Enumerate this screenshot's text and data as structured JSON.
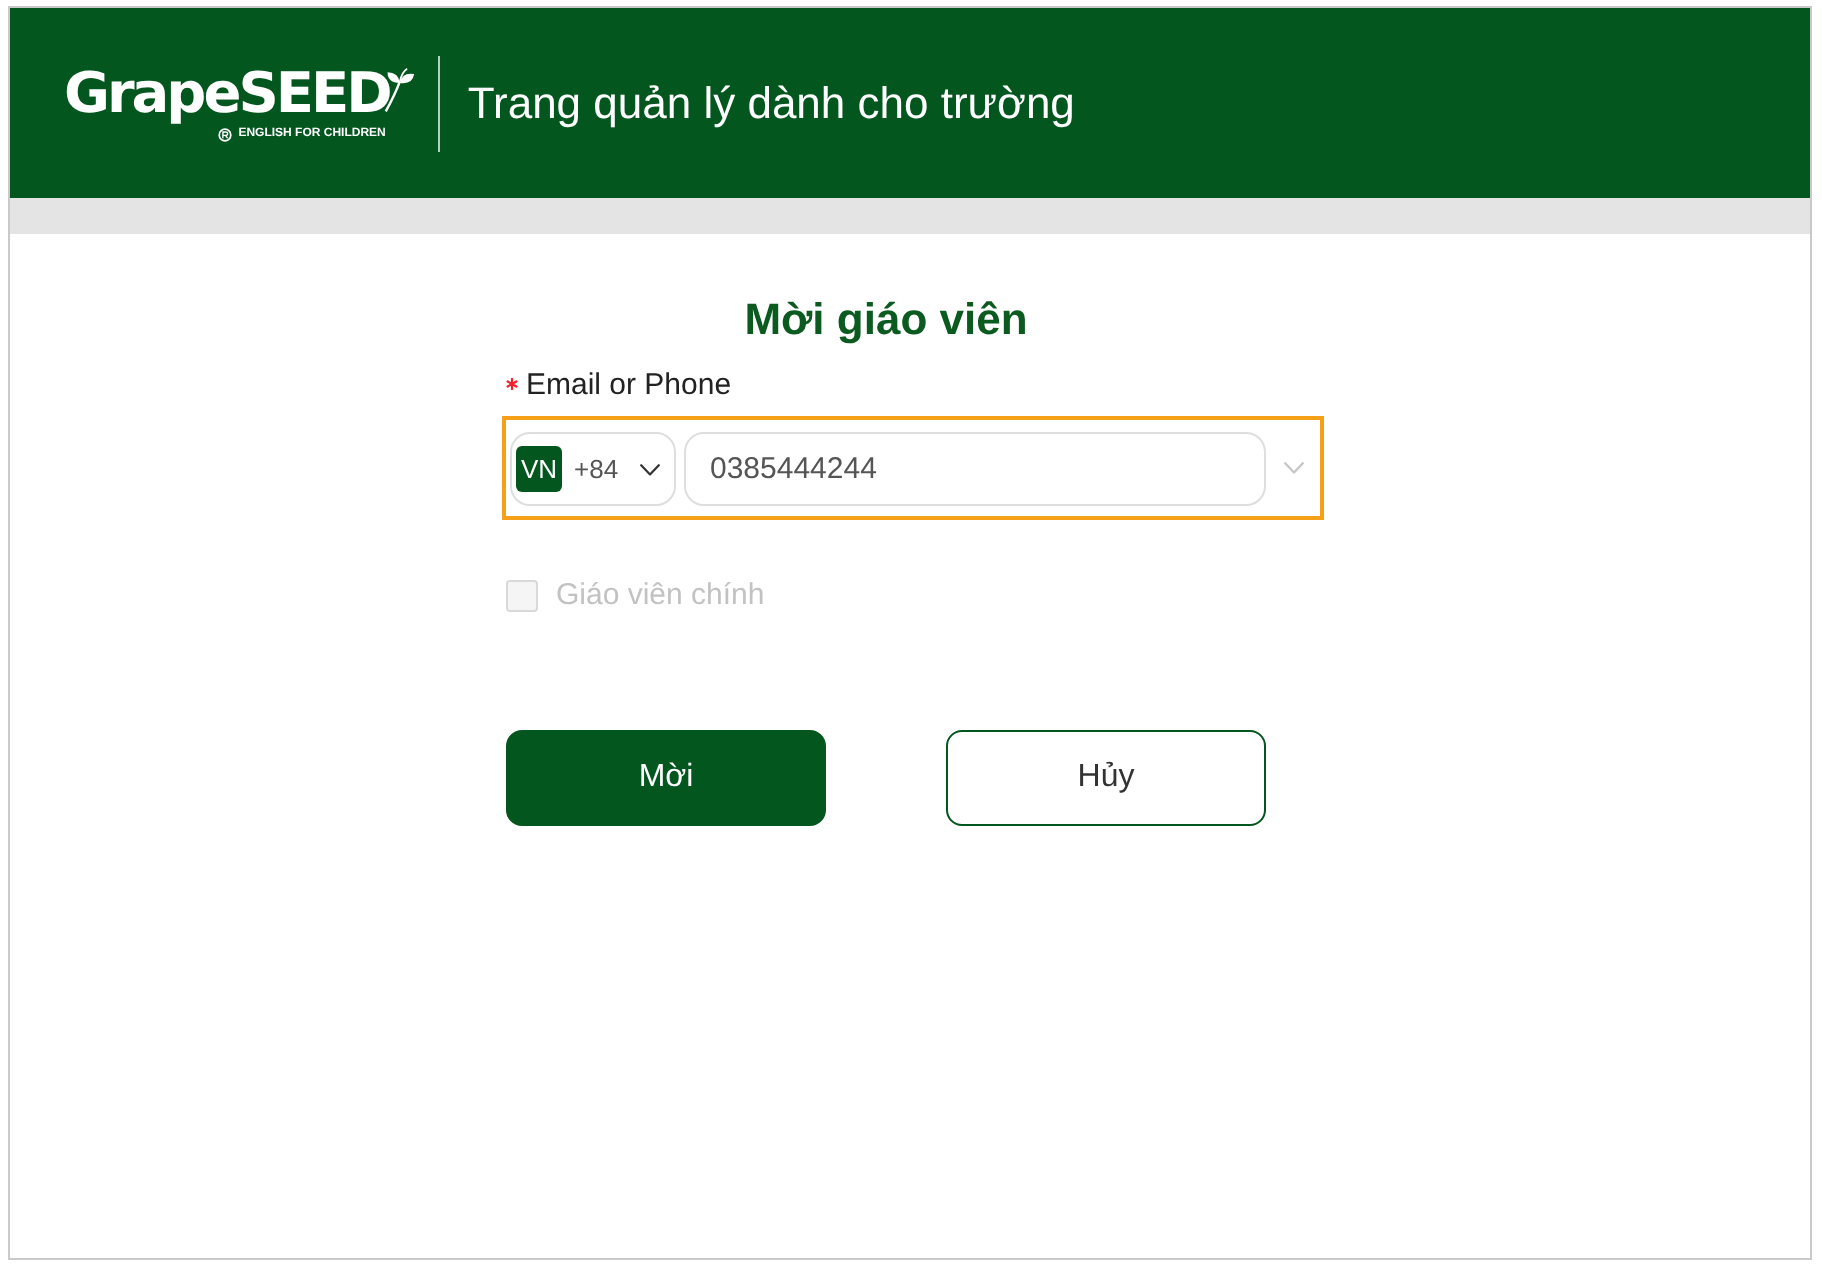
{
  "header": {
    "logo": {
      "name": "GrapeSEED",
      "tagline": "ENGLISH FOR CHILDREN"
    },
    "title": "Trang quản lý dành cho trường"
  },
  "form": {
    "title": "Mời giáo viên",
    "field": {
      "label": "Email or Phone",
      "required": true,
      "focused": true,
      "country": {
        "code": "VN",
        "dial_code": "+84"
      },
      "value": "0385444244"
    },
    "checkbox": {
      "label": "Giáo viên chính",
      "checked": false,
      "disabled": true
    },
    "buttons": [
      {
        "label": "Mời",
        "kind": "primary"
      },
      {
        "label": "Hủy",
        "kind": "secondary"
      }
    ]
  }
}
